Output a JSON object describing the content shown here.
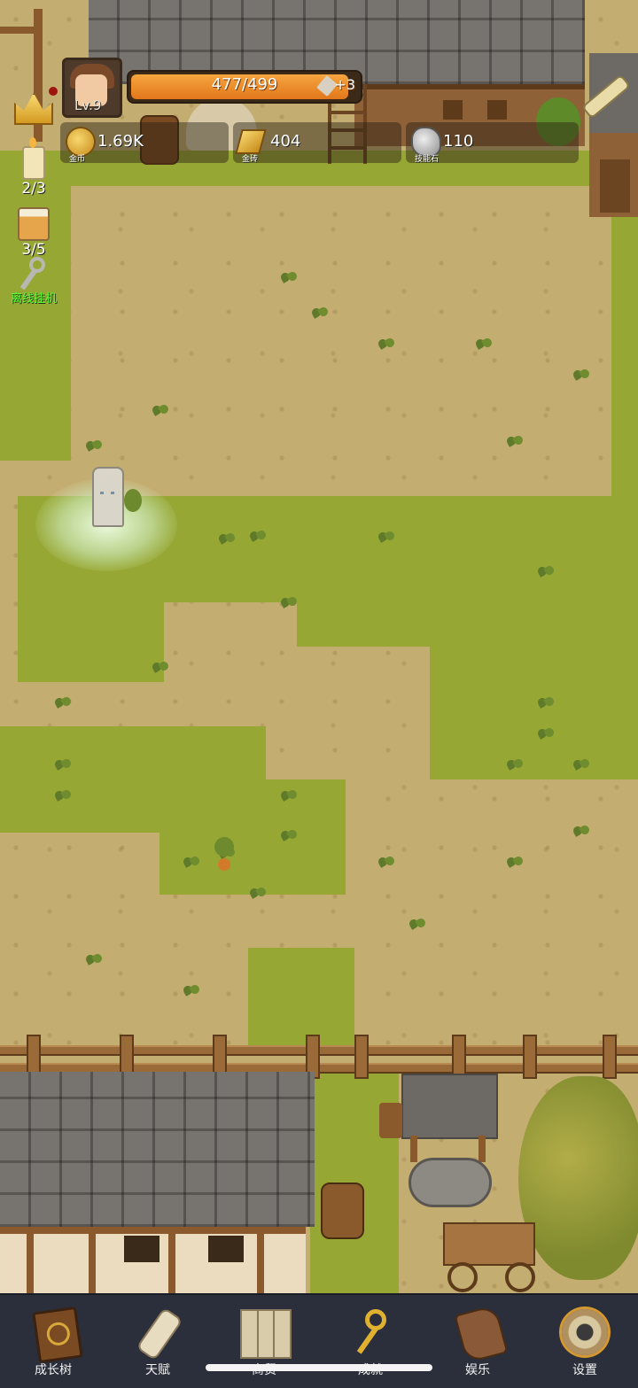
{
  "player": {
    "level_label": "Lv.9"
  },
  "exp": {
    "text": "477/499",
    "current": 477,
    "max": 499,
    "bonus": "+3"
  },
  "resources": [
    {
      "name": "gold-coin",
      "value": "1.69K",
      "label": "金币"
    },
    {
      "name": "gold-brick",
      "value": "404",
      "label": "金砖"
    },
    {
      "name": "skill-stone",
      "value": "110",
      "label": "技能石"
    }
  ],
  "side_buttons": {
    "candle": "2/3",
    "drink": "3/5",
    "idle": "离线挂机"
  },
  "nav": [
    {
      "id": "growth-tree",
      "label": "成长树"
    },
    {
      "id": "talent",
      "label": "天赋"
    },
    {
      "id": "trade",
      "label": "商贸"
    },
    {
      "id": "achievement",
      "label": "成就"
    },
    {
      "id": "entertainment",
      "label": "娱乐"
    },
    {
      "id": "settings",
      "label": "设置"
    }
  ],
  "colors": {
    "grass": "#97a733",
    "dirt": "#c4ad70",
    "exp_fill": "#f08a2a",
    "nav_bg": "#2b2e3b"
  }
}
